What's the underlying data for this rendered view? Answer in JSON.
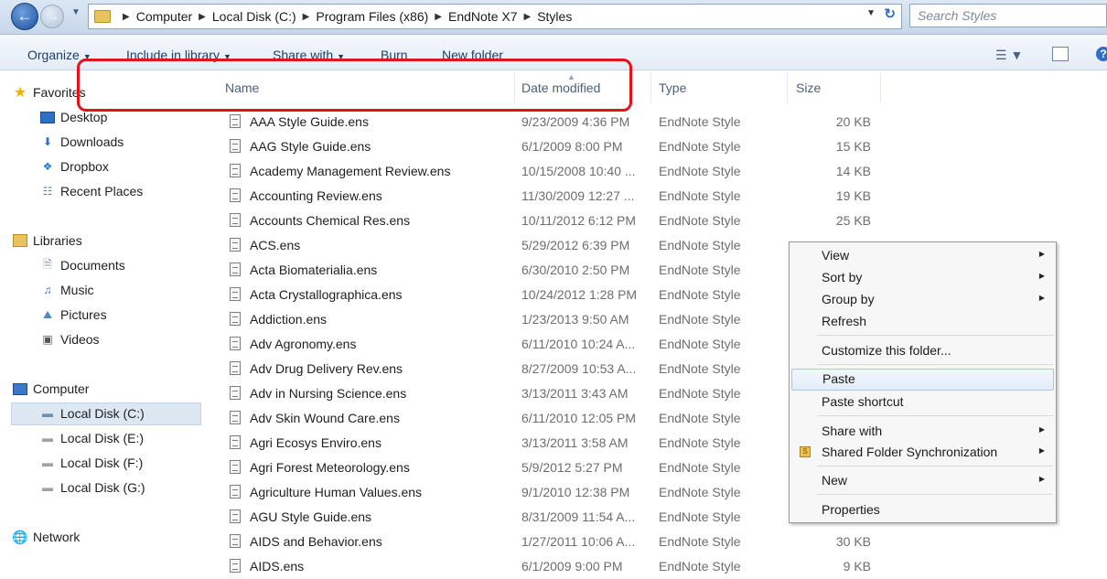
{
  "address": {
    "crumbs": [
      "Computer",
      "Local Disk (C:)",
      "Program Files (x86)",
      "EndNote X7",
      "Styles"
    ],
    "search_placeholder": "Search Styles"
  },
  "toolbar": {
    "organize": "Organize",
    "include": "Include in library",
    "share": "Share with",
    "burn": "Burn",
    "new_folder": "New folder"
  },
  "sidebar": {
    "favorites": "Favorites",
    "desktop": "Desktop",
    "downloads": "Downloads",
    "dropbox": "Dropbox",
    "recent": "Recent Places",
    "libraries": "Libraries",
    "documents": "Documents",
    "music": "Music",
    "pictures": "Pictures",
    "videos": "Videos",
    "computer": "Computer",
    "disk_c": "Local Disk (C:)",
    "disk_e": "Local Disk (E:)",
    "disk_f": "Local Disk (F:)",
    "disk_g": "Local Disk (G:)",
    "network": "Network"
  },
  "columns": {
    "name": "Name",
    "date": "Date modified",
    "type": "Type",
    "size": "Size"
  },
  "files": [
    {
      "name": "AAA Style Guide.ens",
      "date": "9/23/2009 4:36 PM",
      "type": "EndNote Style",
      "size": "20 KB"
    },
    {
      "name": "AAG Style Guide.ens",
      "date": "6/1/2009 8:00 PM",
      "type": "EndNote Style",
      "size": "15 KB"
    },
    {
      "name": "Academy Management Review.ens",
      "date": "10/15/2008 10:40 ...",
      "type": "EndNote Style",
      "size": "14 KB"
    },
    {
      "name": "Accounting Review.ens",
      "date": "11/30/2009 12:27 ...",
      "type": "EndNote Style",
      "size": "19 KB"
    },
    {
      "name": "Accounts Chemical Res.ens",
      "date": "10/11/2012 6:12 PM",
      "type": "EndNote Style",
      "size": "25 KB"
    },
    {
      "name": "ACS.ens",
      "date": "5/29/2012 6:39 PM",
      "type": "EndNote Style",
      "size": ""
    },
    {
      "name": "Acta Biomaterialia.ens",
      "date": "6/30/2010 2:50 PM",
      "type": "EndNote Style",
      "size": ""
    },
    {
      "name": "Acta Crystallographica.ens",
      "date": "10/24/2012 1:28 PM",
      "type": "EndNote Style",
      "size": ""
    },
    {
      "name": "Addiction.ens",
      "date": "1/23/2013 9:50 AM",
      "type": "EndNote Style",
      "size": ""
    },
    {
      "name": "Adv Agronomy.ens",
      "date": "6/11/2010 10:24 A...",
      "type": "EndNote Style",
      "size": ""
    },
    {
      "name": "Adv Drug Delivery Rev.ens",
      "date": "8/27/2009 10:53 A...",
      "type": "EndNote Style",
      "size": ""
    },
    {
      "name": "Adv in Nursing Science.ens",
      "date": "3/13/2011 3:43 AM",
      "type": "EndNote Style",
      "size": ""
    },
    {
      "name": "Adv Skin Wound Care.ens",
      "date": "6/11/2010 12:05 PM",
      "type": "EndNote Style",
      "size": ""
    },
    {
      "name": "Agri Ecosys Enviro.ens",
      "date": "3/13/2011 3:58 AM",
      "type": "EndNote Style",
      "size": ""
    },
    {
      "name": "Agri Forest Meteorology.ens",
      "date": "5/9/2012 5:27 PM",
      "type": "EndNote Style",
      "size": ""
    },
    {
      "name": "Agriculture Human Values.ens",
      "date": "9/1/2010 12:38 PM",
      "type": "EndNote Style",
      "size": ""
    },
    {
      "name": "AGU Style Guide.ens",
      "date": "8/31/2009 11:54 A...",
      "type": "EndNote Style",
      "size": ""
    },
    {
      "name": "AIDS and Behavior.ens",
      "date": "1/27/2011 10:06 A...",
      "type": "EndNote Style",
      "size": "30 KB"
    },
    {
      "name": "AIDS.ens",
      "date": "6/1/2009 9:00 PM",
      "type": "EndNote Style",
      "size": "9 KB"
    }
  ],
  "context_menu": {
    "view": "View",
    "sort_by": "Sort by",
    "group_by": "Group by",
    "refresh": "Refresh",
    "customize": "Customize this folder...",
    "paste": "Paste",
    "paste_shortcut": "Paste shortcut",
    "share_with": "Share with",
    "shared_sync": "Shared Folder Synchronization",
    "new": "New",
    "properties": "Properties"
  },
  "colors": {
    "highlight_box": "#e3121b",
    "menu_hover": "#e3edf8"
  }
}
